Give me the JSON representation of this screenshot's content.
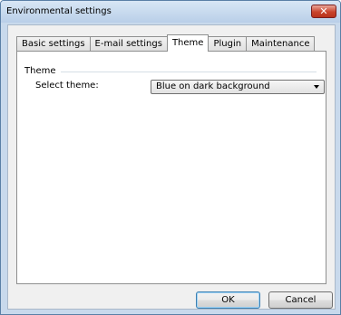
{
  "window": {
    "title": "Environmental settings"
  },
  "tabs": [
    {
      "label": "Basic settings"
    },
    {
      "label": "E-mail settings"
    },
    {
      "label": "Theme"
    },
    {
      "label": "Plugin"
    },
    {
      "label": "Maintenance"
    }
  ],
  "active_tab": "Theme",
  "theme_group": {
    "title": "Theme",
    "select_label": "Select theme:",
    "selected_value": "Blue on dark background"
  },
  "buttons": {
    "ok": "OK",
    "cancel": "Cancel"
  },
  "colors": {
    "frame": "#c8d9ec",
    "close_button": "#c9432c",
    "default_button_border": "#3c7fb1"
  },
  "icons": {
    "close": "close-icon",
    "dropdown": "chevron-down-icon"
  }
}
